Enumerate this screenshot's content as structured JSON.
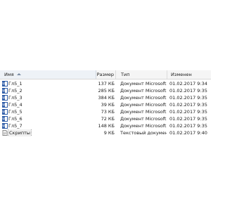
{
  "header": {
    "name_label": "Имя",
    "size_label": "Размер",
    "type_label": "Тип",
    "date_label": "Изменен"
  },
  "files": [
    {
      "name": "Гл5_1",
      "size": "137 КБ",
      "type": "Документ Microsoft ...",
      "date": "01.02.2017 9:34",
      "icon": "word-document-icon"
    },
    {
      "name": "Гл5_2",
      "size": "285 КБ",
      "type": "Документ Microsoft ...",
      "date": "01.02.2017 9:35",
      "icon": "word-document-icon"
    },
    {
      "name": "Гл5_3",
      "size": "384 КБ",
      "type": "Документ Microsoft ...",
      "date": "01.02.2017 9:35",
      "icon": "word-document-icon"
    },
    {
      "name": "Гл5_4",
      "size": "39 КБ",
      "type": "Документ Microsoft ...",
      "date": "01.02.2017 9:35",
      "icon": "word-document-icon"
    },
    {
      "name": "Гл5_5",
      "size": "73 КБ",
      "type": "Документ Microsoft ...",
      "date": "01.02.2017 9:35",
      "icon": "word-document-icon"
    },
    {
      "name": "Гл5_6",
      "size": "72 КБ",
      "type": "Документ Microsoft ...",
      "date": "01.02.2017 9:35",
      "icon": "word-document-icon"
    },
    {
      "name": "Гл5_7",
      "size": "148 КБ",
      "type": "Документ Microsoft ...",
      "date": "01.02.2017 9:35",
      "icon": "word-document-icon"
    },
    {
      "name": "Скрипты",
      "size": "9 КБ",
      "type": "Текстовый документ",
      "date": "01.02.2017 9:40",
      "icon": "text-document-icon"
    }
  ],
  "colors": {
    "word_icon": "#2f5da8",
    "text_icon": "#8a8a8a",
    "header_bg": "#f5f5f5"
  }
}
